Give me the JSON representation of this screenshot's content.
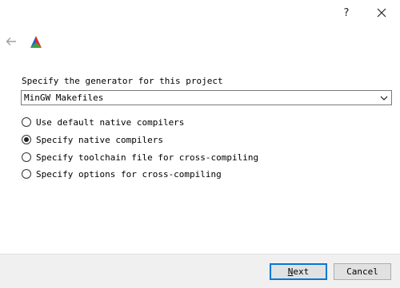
{
  "titlebar": {
    "help_label": "?",
    "close_icon": "close-icon"
  },
  "header": {
    "back_icon": "back-arrow-icon",
    "logo_icon": "cmake-logo-icon"
  },
  "generator": {
    "label": "Specify the generator for this project",
    "selected": "MinGW Makefiles"
  },
  "options": [
    {
      "label": "Use default native compilers",
      "checked": false
    },
    {
      "label": "Specify native compilers",
      "checked": true
    },
    {
      "label": "Specify toolchain file for cross-compiling",
      "checked": false
    },
    {
      "label": "Specify options for cross-compiling",
      "checked": false
    }
  ],
  "buttons": {
    "next": {
      "mnemonic": "N",
      "rest": "ext"
    },
    "cancel": "Cancel"
  },
  "colors": {
    "focus_border": "#0078d7",
    "footer_bg": "#f0f0f0"
  }
}
